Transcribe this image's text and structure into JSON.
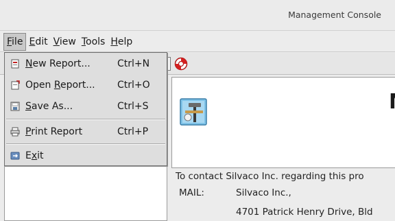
{
  "window": {
    "title": "Management Console"
  },
  "menubar": {
    "items": [
      {
        "pre": "",
        "ul": "F",
        "post": "ile"
      },
      {
        "pre": "",
        "ul": "E",
        "post": "dit"
      },
      {
        "pre": "",
        "ul": "V",
        "post": "iew"
      },
      {
        "pre": "",
        "ul": "T",
        "post": "ools"
      },
      {
        "pre": "",
        "ul": "H",
        "post": "elp"
      }
    ]
  },
  "file_menu": {
    "items": [
      {
        "pre": "",
        "ul": "N",
        "post": "ew Report...",
        "shortcut": "Ctrl+N",
        "icon": "new-report-icon"
      },
      {
        "pre": "Open ",
        "ul": "R",
        "post": "eport...",
        "shortcut": "Ctrl+O",
        "icon": "open-report-icon"
      },
      {
        "pre": "",
        "ul": "S",
        "post": "ave As...",
        "shortcut": "Ctrl+S",
        "icon": "save-icon"
      },
      {
        "pre": "",
        "ul": "P",
        "post": "rint Report",
        "shortcut": "Ctrl+P",
        "icon": "print-icon"
      },
      {
        "pre": "E",
        "ul": "x",
        "post": "it",
        "shortcut": "",
        "icon": "exit-icon"
      }
    ]
  },
  "about": {
    "heading_fragment": "M",
    "contact_line": "To contact Silvaco Inc. regarding this pro",
    "mail_label": "MAIL:",
    "mail_line1": "Silvaco Inc.,",
    "mail_line2": "4701 Patrick Henry Drive, Bld"
  }
}
